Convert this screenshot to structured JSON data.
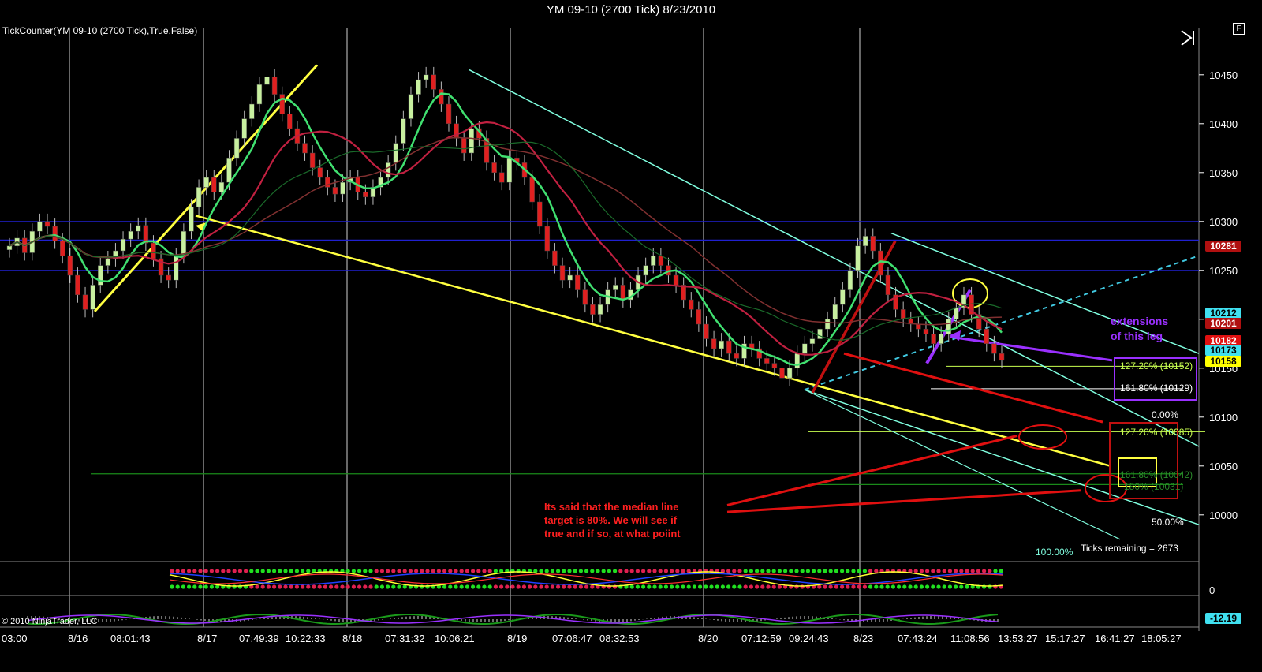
{
  "window": {
    "title": "YM 09-10 (2700 Tick)  8/23/2010"
  },
  "indicator_label": "TickCounter(YM 09-10 (2700 Tick),True,False)",
  "copyright": "© 2010 NinjaTrader, LLC",
  "ticks_remaining": "Ticks remaining = 2673",
  "f_button": "F",
  "icons": {
    "play": "play-pause-icon"
  },
  "price_tags": [
    {
      "value": "10281",
      "bg": "#b01010",
      "fg": "#ffffff"
    },
    {
      "value": "10212",
      "bg": "#40e0f0",
      "fg": "#000000"
    },
    {
      "value": "10201",
      "bg": "#b01010",
      "fg": "#ffffff"
    },
    {
      "value": "10182",
      "bg": "#e01010",
      "fg": "#ffffff"
    },
    {
      "value": "10173",
      "bg": "#40e0f0",
      "fg": "#000000"
    },
    {
      "value": "10158",
      "bg": "#ffff00",
      "fg": "#000000"
    }
  ],
  "lower_panel_value": "-12.19",
  "middle_panel_value": "0",
  "annotations": {
    "median_line_note": [
      "Its said that the median line",
      "target is 80%.  We will see if",
      "true and if so, at what poiint"
    ],
    "extensions_note": [
      "extensions",
      "of this leg"
    ]
  },
  "fib_labels": [
    {
      "text": "127.20% (10152)",
      "color": "#c8ff50"
    },
    {
      "text": "161.80% (10129)",
      "color": "#ffffff"
    },
    {
      "text": "0.00%",
      "color": "#ffffff"
    },
    {
      "text": "127.20% (10085)",
      "color": "#c8ff50"
    },
    {
      "text": "161.80% (10042)",
      "color": "#2a8a2a"
    },
    {
      "text": "180% (10031)",
      "color": "#2a8a2a"
    },
    {
      "text": "50.00%",
      "color": "#ffffff"
    },
    {
      "text": "100.00%",
      "color": "#80ffe0"
    }
  ],
  "colors": {
    "background": "#000000",
    "up_candle": "#c8f0a0",
    "down_candle": "#e02020",
    "hline": "#2020d0",
    "yellow": "#ffff40",
    "cyan": "#80ffe0",
    "purple": "#9a30ff",
    "red": "#e01010"
  },
  "chart_data": {
    "type": "candlestick",
    "title": "YM 09-10 (2700 Tick)  8/23/2010",
    "ylim": [
      9970,
      10470
    ],
    "y_ticks": [
      10000,
      10050,
      10100,
      10150,
      10200,
      10250,
      10300,
      10350,
      10400,
      10450
    ],
    "x_labels": [
      "03:00",
      "8/16",
      "08:01:43",
      "8/17",
      "07:49:39",
      "10:22:33",
      "8/18",
      "07:31:32",
      "10:06:21",
      "8/19",
      "07:06:47",
      "08:32:53",
      "8/20",
      "07:12:59",
      "09:24:43",
      "8/23",
      "07:43:24",
      "11:08:56",
      "13:53:27",
      "15:17:27",
      "16:41:27",
      "18:05:27"
    ],
    "horizontal_levels": [
      10300,
      10281,
      10250
    ],
    "series": [
      {
        "name": "Close",
        "values": [
          10275,
          10283,
          10268,
          10290,
          10300,
          10295,
          10280,
          10265,
          10245,
          10225,
          10210,
          10235,
          10255,
          10262,
          10270,
          10282,
          10290,
          10296,
          10278,
          10262,
          10245,
          10240,
          10265,
          10290,
          10315,
          10335,
          10345,
          10330,
          10340,
          10365,
          10385,
          10405,
          10420,
          10440,
          10448,
          10430,
          10410,
          10395,
          10380,
          10370,
          10355,
          10345,
          10335,
          10328,
          10340,
          10345,
          10330,
          10325,
          10335,
          10345,
          10360,
          10380,
          10405,
          10430,
          10445,
          10450,
          10435,
          10420,
          10400,
          10385,
          10370,
          10395,
          10385,
          10360,
          10350,
          10340,
          10365,
          10360,
          10345,
          10320,
          10295,
          10270,
          10255,
          10240,
          10245,
          10230,
          10215,
          10205,
          10215,
          10230,
          10235,
          10220,
          10230,
          10245,
          10255,
          10265,
          10255,
          10245,
          10235,
          10220,
          10210,
          10195,
          10180,
          10170,
          10178,
          10165,
          10160,
          10175,
          10170,
          10160,
          10155,
          10150,
          10140,
          10150,
          10165,
          10175,
          10180,
          10190,
          10200,
          10215,
          10230,
          10250,
          10275,
          10285,
          10270,
          10245,
          10225,
          10210,
          10200,
          10195,
          10190,
          10185,
          10175,
          10185,
          10200,
          10212,
          10225,
          10205,
          10190,
          10175,
          10165,
          10158
        ]
      }
    ]
  }
}
